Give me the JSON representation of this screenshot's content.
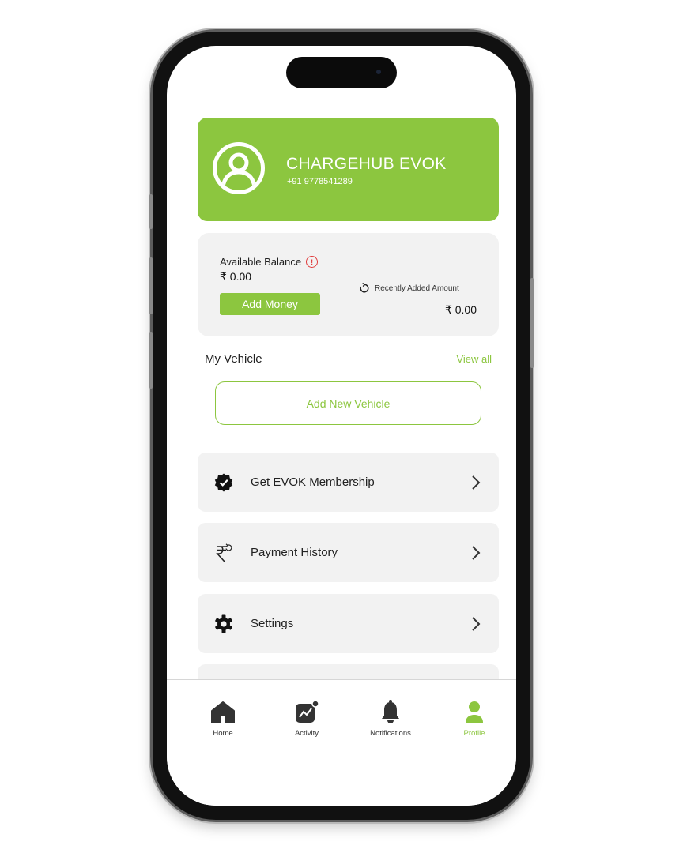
{
  "profile": {
    "name": "CHARGEHUB EVOK",
    "phone": "+91 9778541289"
  },
  "wallet": {
    "available_balance_label": "Available Balance",
    "info_glyph": "!",
    "balance": "₹ 0.00",
    "add_money_label": "Add Money",
    "recent_label": "Recently Added Amount",
    "recent_amount": "₹ 0.00"
  },
  "vehicles": {
    "section_title": "My Vehicle",
    "view_all_label": "View all",
    "add_new_label": "Add New Vehicle"
  },
  "menu": [
    {
      "label": "Get EVOK Membership",
      "icon": "verified-badge-icon"
    },
    {
      "label": "Payment History",
      "icon": "rupee-refresh-icon"
    },
    {
      "label": "Settings",
      "icon": "gear-icon"
    }
  ],
  "nav": [
    {
      "label": "Home",
      "icon": "home-icon"
    },
    {
      "label": "Activity",
      "icon": "activity-chart-icon"
    },
    {
      "label": "Notifications",
      "icon": "bell-icon"
    },
    {
      "label": "Profile",
      "icon": "user-icon",
      "active": true
    }
  ],
  "colors": {
    "accent": "#8cc63f",
    "card_bg": "#f2f2f2",
    "alert": "#e03a3a"
  }
}
